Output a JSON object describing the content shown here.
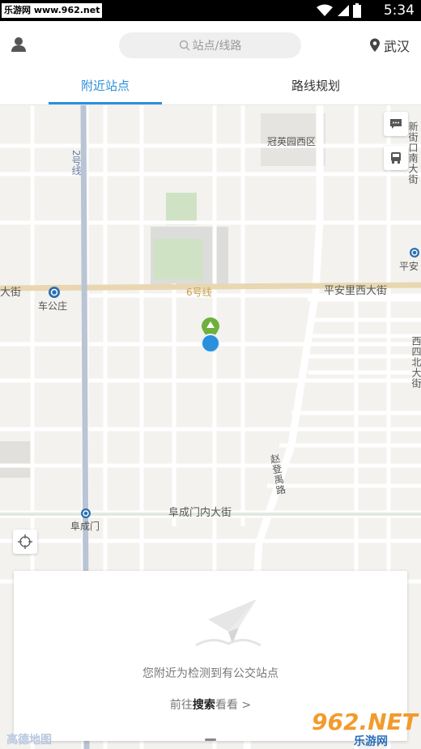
{
  "status_bar": {
    "site_label": "乐游网 www.962.net",
    "time": "5:34"
  },
  "header": {
    "search_placeholder": "站点/线路",
    "city": "武汉"
  },
  "tabs": [
    {
      "label": "附近站点",
      "active": true
    },
    {
      "label": "路线规划",
      "active": false
    }
  ],
  "map": {
    "labels": {
      "guanying": "冠英园西区",
      "xinjiekou": "新街口南大街",
      "line2": "2号线",
      "line6": "6号线",
      "dajie_left": "大街",
      "chegongzhuang": "车公庄",
      "pinganli_east": "平安里西大街",
      "pinganli_stub": "平安",
      "xisi": "西四北大街",
      "zhaodengyu": "赵登禹路",
      "fuchengmen_street": "阜成门内大街",
      "fuchengmen": "阜成门"
    },
    "accent_color": "#2b8fdc"
  },
  "card": {
    "message": "您附近为检测到有公交站点",
    "link_prefix": "前往",
    "link_keyword": "搜索",
    "link_suffix": "看看 >"
  },
  "map_brand": "高德地图",
  "watermark": {
    "number": "962.NET",
    "sub": "乐游网"
  }
}
